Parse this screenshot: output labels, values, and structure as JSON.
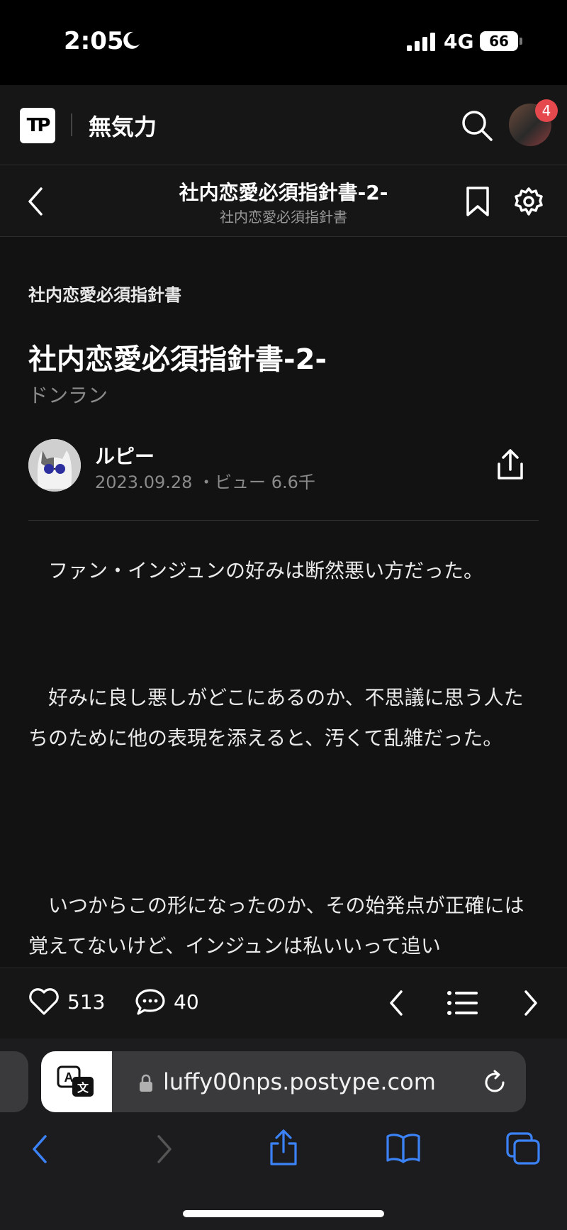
{
  "status_bar": {
    "time": "2:05",
    "network": "4G",
    "battery": "66"
  },
  "app_header": {
    "logo_text": "TP",
    "channel_name": "無気力",
    "notification_count": "4"
  },
  "episode_bar": {
    "title": "社内恋愛必須指針書-2-",
    "subtitle": "社内恋愛必須指針書"
  },
  "article": {
    "series_name": "社内恋愛必須指針書",
    "title": "社内恋愛必須指針書-2-",
    "subtitle": "ドンラン",
    "author": "ルピー",
    "date": "2023.09.28",
    "views": "・ビュー 6.6千",
    "paragraphs": [
      "　ファン・インジュンの好みは断然悪い方だった。",
      "　好みに良し悪しがどこにあるのか、不思議に思う人たちのために他の表現を添えると、汚くて乱雑だった。",
      "　いつからこの形になったのか、その始発点が正確には覚えてないけど、インジュンは私いいって追い"
    ]
  },
  "reader_bar": {
    "likes": "513",
    "comments": "40"
  },
  "safari": {
    "url": "luffy00nps.postype.com"
  },
  "colors": {
    "background": "#121212",
    "accent_blue": "#3b82f6",
    "badge_red": "#e5484d"
  }
}
